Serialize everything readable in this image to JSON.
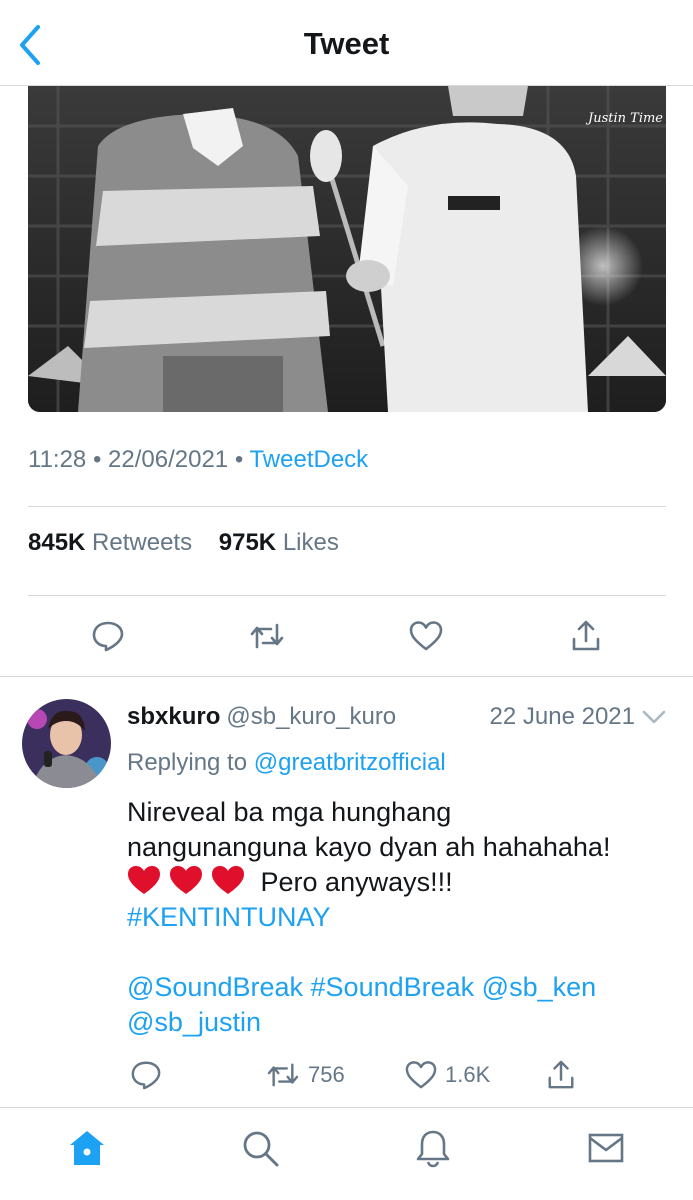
{
  "header": {
    "title": "Tweet",
    "back_icon": "chevron-left-icon"
  },
  "tweet": {
    "time": "11:28",
    "separator": "•",
    "date": "22/06/2021",
    "source": "TweetDeck",
    "retweets": {
      "count": "845K",
      "label": "Retweets"
    },
    "likes": {
      "count": "975K",
      "label": "Likes"
    },
    "image_watermark": "Justin Time",
    "actions": [
      "reply-icon",
      "retweet-icon",
      "like-icon",
      "share-icon"
    ]
  },
  "reply": {
    "name": "sbxkuro",
    "handle": "@sb_kuro_kuro",
    "date": "22 June 2021",
    "replying_prefix": "Replying to",
    "replying_to": "@greatbritzofficial",
    "line1": "Nireveal ba mga hunghang",
    "line2": "nangunanguna kayo dyan ah hahahaha!",
    "line3_text": "Pero anyways!!!",
    "hashtag1": "#KENTINTUNAY",
    "mention_soundbreak": "@SoundBreak",
    "hashtag_soundbreak": "#SoundBreak",
    "mention_ken": "@sb_ken",
    "mention_justin": "@sb_justin",
    "retweet_count": "756",
    "like_count": "1.6K"
  },
  "tabbar": {
    "items": [
      "home-icon",
      "search-icon",
      "notifications-icon",
      "messages-icon"
    ]
  },
  "colors": {
    "accent": "#1da1f2",
    "text": "#14171a",
    "muted": "#657786",
    "divider": "#d6d9db",
    "heart": "#e0102d"
  }
}
